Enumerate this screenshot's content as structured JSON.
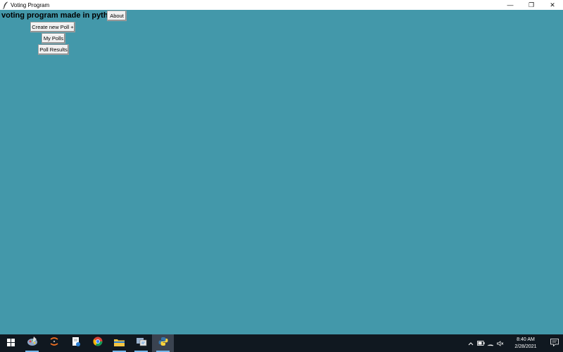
{
  "window": {
    "title": "Voting Program",
    "controls": {
      "minimize": "—",
      "restore": "❐",
      "close": "✕"
    }
  },
  "app": {
    "heading": "voting program made in python",
    "about_label": "About",
    "create_poll_label": "Create new Poll +",
    "my_polls_label": "My Polls",
    "poll_results_label": "Poll Results"
  },
  "colors": {
    "background": "#4398aa",
    "taskbar": "#101820"
  },
  "taskbar": {
    "apps": [
      "settings-app",
      "app-orange",
      "notepad-app",
      "chrome",
      "file-explorer",
      "network-app",
      "python"
    ],
    "clock_time": "8:40 AM",
    "clock_date": "2/28/2021"
  }
}
